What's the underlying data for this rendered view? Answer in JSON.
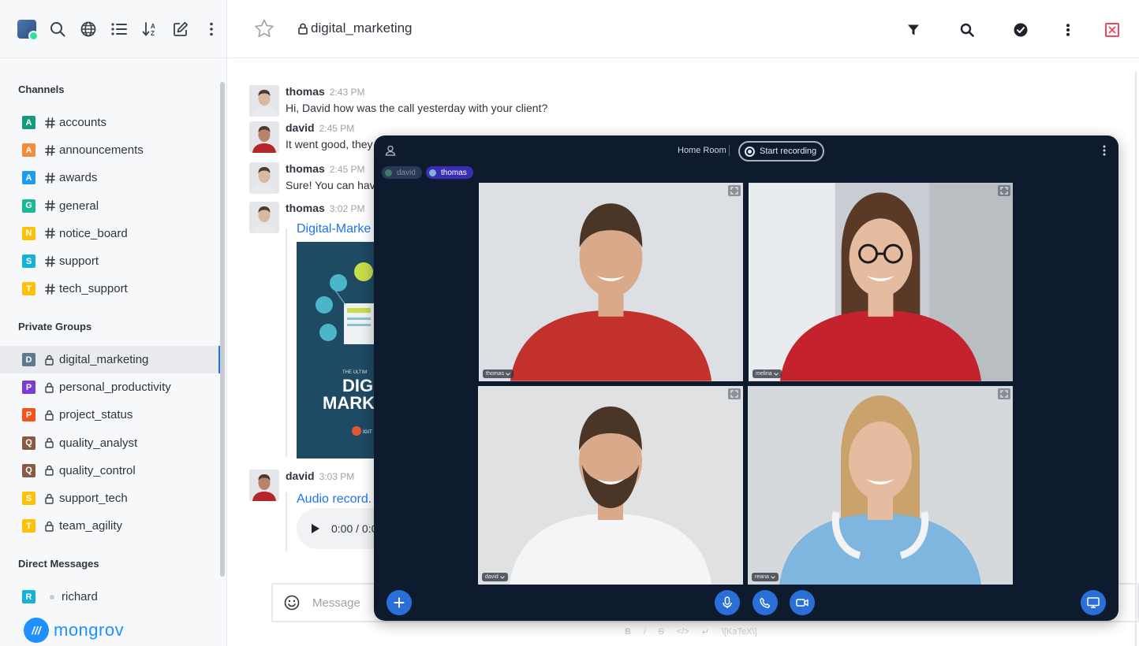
{
  "sidebar": {
    "sections": {
      "channels": "Channels",
      "private_groups": "Private Groups",
      "direct_messages": "Direct Messages"
    },
    "channels": [
      {
        "letter": "A",
        "name": "accounts",
        "color": "#159a7a"
      },
      {
        "letter": "A",
        "name": "announcements",
        "color": "#f38c39"
      },
      {
        "letter": "A",
        "name": "awards",
        "color": "#1d9bf0"
      },
      {
        "letter": "G",
        "name": "general",
        "color": "#1ab896"
      },
      {
        "letter": "N",
        "name": "notice_board",
        "color": "#ffc107"
      },
      {
        "letter": "S",
        "name": "support",
        "color": "#16b1d7"
      },
      {
        "letter": "T",
        "name": "tech_support",
        "color": "#ffc107"
      }
    ],
    "private_groups": [
      {
        "letter": "D",
        "name": "digital_marketing",
        "color": "#5e7a8e"
      },
      {
        "letter": "P",
        "name": "personal_productivity",
        "color": "#7a3dcf"
      },
      {
        "letter": "P",
        "name": "project_status",
        "color": "#f4531d"
      },
      {
        "letter": "Q",
        "name": "quality_analyst",
        "color": "#8a5a44"
      },
      {
        "letter": "Q",
        "name": "quality_control",
        "color": "#8a5a44"
      },
      {
        "letter": "S",
        "name": "support_tech",
        "color": "#ffc107"
      },
      {
        "letter": "T",
        "name": "team_agility",
        "color": "#ffc107"
      }
    ],
    "direct_messages": [
      {
        "letter": "R",
        "name": "richard",
        "color": "#16b1d7"
      }
    ],
    "brand": "mongrov"
  },
  "header": {
    "room_title": "digital_marketing"
  },
  "messages": [
    {
      "user": "thomas",
      "time": "2:43 PM",
      "text": "Hi, David how was the call yesterday with your client?"
    },
    {
      "user": "david",
      "time": "2:45 PM",
      "text": "It went good, they"
    },
    {
      "user": "thomas",
      "time": "2:45 PM",
      "text": "Sure! You can have"
    },
    {
      "user": "thomas",
      "time": "3:02 PM",
      "attachment": "Digital-Marke"
    },
    {
      "user": "david",
      "time": "3:03 PM",
      "attachment": "Audio record."
    }
  ],
  "attachment_image_text": [
    "THE ULTIM",
    "DIG",
    "MARK",
    "IGIT"
  ],
  "audio_time": "0:00 / 0:0",
  "composer": {
    "placeholder": "Message",
    "formatting": [
      "B",
      "i",
      "S",
      "</>",
      "↵",
      "\\[KaTeX\\]"
    ]
  },
  "call": {
    "room_name": "Home Room",
    "record_label": "Start recording",
    "participants": [
      {
        "name": "david",
        "active": false
      },
      {
        "name": "thomas",
        "active": true
      }
    ],
    "tiles": [
      {
        "label": "thomas",
        "shirt": "#c2312b",
        "bg": "#dcdfe3"
      },
      {
        "label": "melina",
        "shirt": "#c4232e",
        "bg": "#c7cdd3"
      },
      {
        "label": "david",
        "shirt": "#f4f5f6",
        "bg": "#dfe1e3"
      },
      {
        "label": "reana",
        "shirt": "#7fb6e0",
        "bg": "#d6d9dc"
      }
    ]
  }
}
